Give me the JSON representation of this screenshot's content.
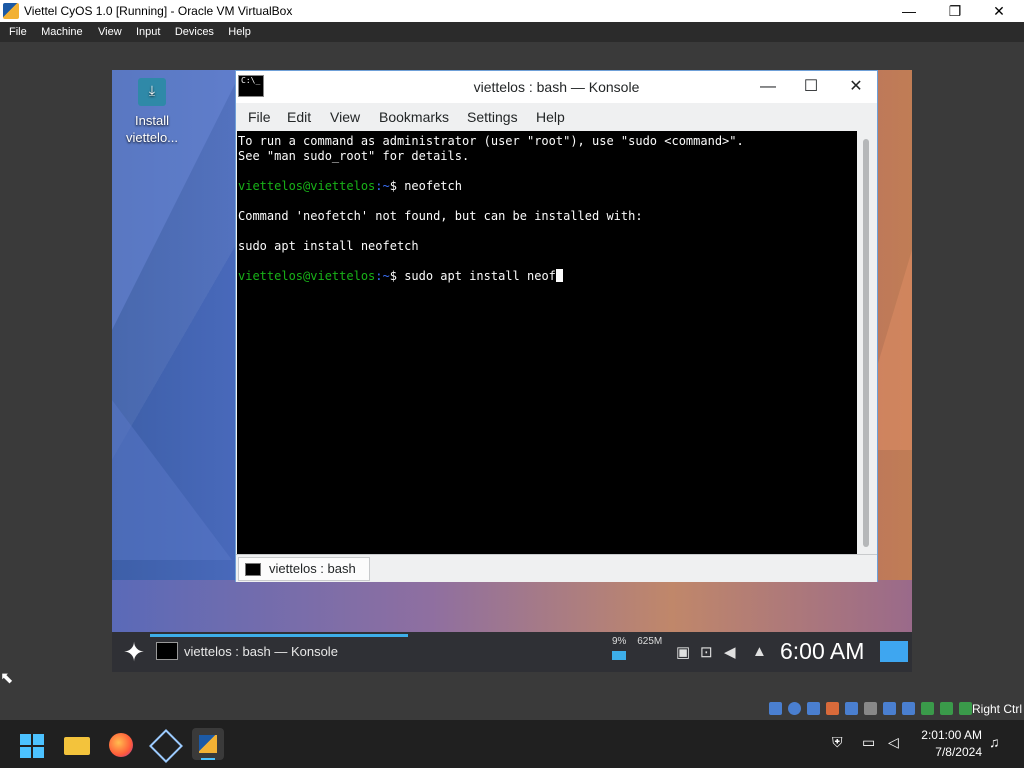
{
  "host": {
    "window_title": "Viettel CyOS 1.0 [Running] - Oracle VM VirtualBox",
    "window_controls": [
      "—",
      "❐",
      "✕"
    ],
    "menu": [
      "File",
      "Machine",
      "View",
      "Input",
      "Devices",
      "Help"
    ],
    "status_hotkey": "Right Ctrl"
  },
  "desktop": {
    "icon_label_line1": "Install",
    "icon_label_line2": "viettelo..."
  },
  "konsole": {
    "title": "viettelos : bash — Konsole",
    "icon_text": "C:\\_",
    "controls": {
      "minimize": "—",
      "maximize": "☐",
      "close": "✕"
    },
    "menu": [
      "File",
      "Edit",
      "View",
      "Bookmarks",
      "Settings",
      "Help"
    ],
    "terminal": {
      "line1": "To run a command as administrator (user \"root\"), use \"sudo <command>\".",
      "line2": "See \"man sudo_root\" for details.",
      "prompt_user": "viettelos@viettelos",
      "prompt_path": ":~",
      "prompt_symbol": "$ ",
      "cmd1": "neofetch",
      "line3": "Command 'neofetch' not found, but can be installed with:",
      "line4": "sudo apt install neofetch",
      "cmd2": "sudo apt install neof"
    },
    "tab_label": "viettelos : bash"
  },
  "guest_panel": {
    "task_label": "viettelos : bash — Konsole",
    "cpu": "9%",
    "mem": "625M",
    "clock": "6:00 AM"
  },
  "windows": {
    "time": "2:01:00 AM",
    "date": "7/8/2024"
  }
}
